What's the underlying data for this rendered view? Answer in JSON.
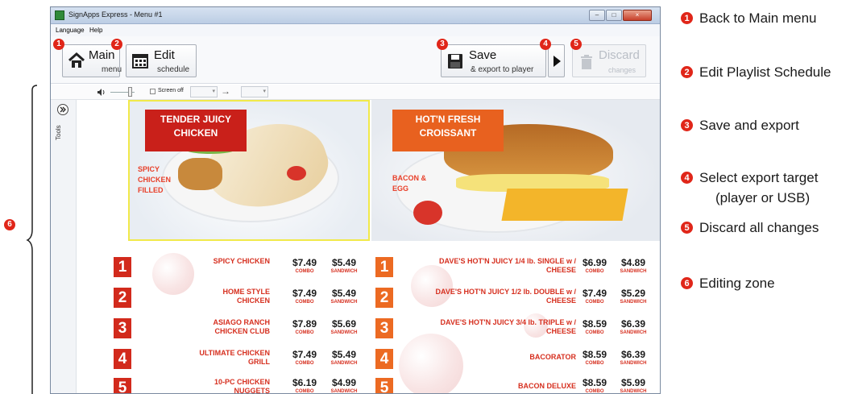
{
  "window": {
    "title": "SignApps Express - Menu #1",
    "controls": {
      "minimize": "–",
      "maximize": "□",
      "close": "×"
    }
  },
  "menubar": {
    "language": "Language",
    "help": "Help"
  },
  "toolbar": {
    "main": {
      "big": "Main",
      "small": "menu"
    },
    "edit": {
      "big": "Edit",
      "small": "schedule"
    },
    "save": {
      "big": "Save",
      "small": "& export to player"
    },
    "discard": {
      "big": "Discard",
      "small": "changes"
    }
  },
  "subbar": {
    "screen_off": "Screen off",
    "arrow": "→"
  },
  "tools_label": "Tools",
  "callouts": [
    "1",
    "2",
    "3",
    "4",
    "5",
    "6"
  ],
  "menu_board": {
    "banner_left": "TENDER JUICY CHICKEN",
    "banner_right": "HOT'N FRESH CROISSANT",
    "tag_left": "SPICY CHICKEN FILLED",
    "tag_right": "BACON & EGG",
    "combo_label": "COMBO",
    "sandwich_label": "SANDWICH",
    "left_items": [
      {
        "num": "1",
        "name": "SPICY CHICKEN",
        "combo": "$7.49",
        "sandwich": "$5.49"
      },
      {
        "num": "2",
        "name": "HOME STYLE CHICKEN",
        "combo": "$7.49",
        "sandwich": "$5.49"
      },
      {
        "num": "3",
        "name": "ASIAGO RANCH CHICKEN CLUB",
        "combo": "$7.89",
        "sandwich": "$5.69"
      },
      {
        "num": "4",
        "name": "ULTIMATE CHICKEN GRILL",
        "combo": "$7.49",
        "sandwich": "$5.49"
      },
      {
        "num": "5",
        "name": "10-PC CHICKEN NUGGETS",
        "combo": "$6.19",
        "sandwich": "$4.99"
      }
    ],
    "right_items": [
      {
        "num": "1",
        "name": "DAVE'S HOT'N JUICY 1/4 lb. SINGLE w / CHEESE",
        "combo": "$6.99",
        "sandwich": "$4.89"
      },
      {
        "num": "2",
        "name": "DAVE'S HOT'N JUICY 1/2 lb. DOUBLE w / CHEESE",
        "combo": "$7.49",
        "sandwich": "$5.29"
      },
      {
        "num": "3",
        "name": "DAVE'S HOT'N JUICY 3/4 lb. TRIPLE w / CHEESE",
        "combo": "$8.59",
        "sandwich": "$6.39"
      },
      {
        "num": "4",
        "name": "BACORATOR",
        "combo": "$8.59",
        "sandwich": "$6.39"
      },
      {
        "num": "5",
        "name": "BACON DELUXE",
        "combo": "$8.59",
        "sandwich": "$5.99"
      }
    ]
  },
  "legend": [
    {
      "num": "1",
      "text": "Back to Main menu"
    },
    {
      "num": "2",
      "text": "Edit Playlist Schedule"
    },
    {
      "num": "3",
      "text": "Save and export"
    },
    {
      "num": "4",
      "text": "Select export target",
      "text2": "(player or USB)"
    },
    {
      "num": "5",
      "text": "Discard all changes"
    },
    {
      "num": "6",
      "text": "Editing zone"
    }
  ],
  "colors": {
    "callout": "#e02619",
    "banner_left": "#c9201a",
    "banner_right": "#e8611f",
    "num_left": "#d22a1c",
    "num_right": "#ec6a22"
  }
}
